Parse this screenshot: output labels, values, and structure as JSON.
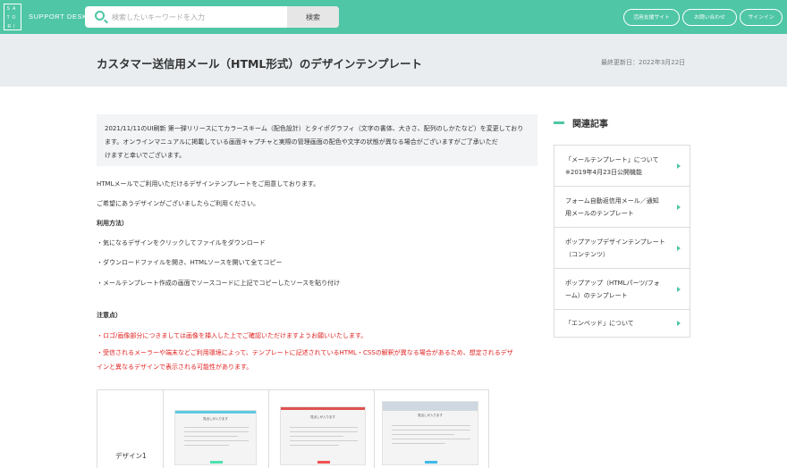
{
  "header": {
    "logo_letters": [
      "SA",
      "TO",
      "RI"
    ],
    "brand": "SUPPORT DESK",
    "search_placeholder": "検索したいキーワードを入力",
    "search_button": "検索",
    "nav": [
      "活用支援サイト",
      "お問い合わせ",
      "サインイン"
    ],
    "accent_color": "#4fc6a6"
  },
  "title": {
    "text": "カスタマー送信用メール（HTML形式）のデザインテンプレート",
    "updated": "最終更新日：2022年3月22日"
  },
  "notice": {
    "lines": [
      "2021/11/11のUI刷新 第一弾リリースにてカラースキーム（配色設計）とタイポグラフィ（文字の書体、大きさ、配列のしかたなど）を変更しており",
      "ます。オンラインマニュアルに掲載している画面キャプチャと実際の管理画面の配色や文字の状態が異なる場合がございますがご了承いただ",
      "けますと幸いでございます。"
    ]
  },
  "body": {
    "intro1": "HTMLメールでご利用いただけるデザインテンプレートをご用意しております。",
    "intro2": "ご希望にあうデザインがございましたらご利用ください。",
    "usage_heading": "利用方法）",
    "usage": [
      "・気になるデザインをクリックしてファイルをダウンロード",
      "・ダウンロードファイルを開き、HTMLソースを開いて全てコピー",
      "・メールテンプレート作成の画面でソースコードに上記でコピーしたソースを貼り付け"
    ],
    "caution_heading": "注意点）",
    "caution1": "・ロゴ/画像部分につきましては画像を挿入した上でご確認いただけますようお願いいたします。",
    "caution2_line1": "・受信されるメーラーや端末などご利用環境によって、テンプレートに記述されているHTML・CSSの解釈が異なる場合があるため、想定されるデザ",
    "caution2_line2": "インと異なるデザインで表示される可能性があります。",
    "caution_color": "#e02020"
  },
  "designs": {
    "row_label": "デザイン1",
    "thumbs": [
      {
        "title": "見出しが入ります",
        "bar_color": "#5ec9e0",
        "cta_color": "#4fe0b0"
      },
      {
        "title": "見出しが入ります",
        "bar_color": "#e05252",
        "cta_color": "#f05050"
      },
      {
        "title": "見出しが入ります",
        "bar_color": "#cfd8e0",
        "cta_color": "#40b8e8"
      }
    ]
  },
  "sidebar": {
    "heading": "関連記事",
    "items": [
      {
        "line1": "「メールテンプレート」について",
        "line2": "※2019年4月23日公開機能"
      },
      {
        "line1": "フォーム自動返信用メール／通知",
        "line2": "用メールのテンプレート"
      },
      {
        "line1": "ポップアップデザインテンプレート",
        "line2": "（コンテンツ）"
      },
      {
        "line1": "ポップアップ（HTMLパーツ/フォ",
        "line2": "ーム）のテンプレート"
      },
      {
        "line1": "「エンベッド」について",
        "line2": ""
      }
    ]
  }
}
